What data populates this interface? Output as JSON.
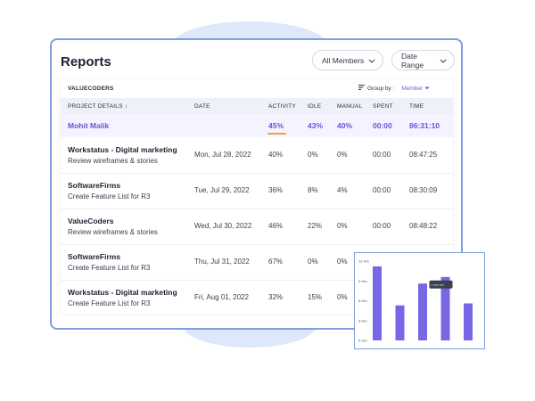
{
  "panel": {
    "title": "Reports",
    "members_dropdown": "All Members",
    "range_dropdown": "Date Range"
  },
  "table": {
    "org": "VALUECODERS",
    "group_label": "Group by :",
    "group_value": "Member",
    "columns": [
      "PROJECT DETAILS ↑",
      "DATE",
      "ACTIVITY",
      "IDLE",
      "MANUAL",
      "SPENT",
      "TIME"
    ],
    "summary": {
      "name": "Mohit Malik",
      "activity": "45%",
      "idle": "43%",
      "manual": "40%",
      "spent": "00:00",
      "time": "86:31:10"
    },
    "rows": [
      {
        "project": "Workstatus - Digital marketing",
        "task": "Review wireframes & stories",
        "date": "Mon, Jul 28, 2022",
        "activity": "40%",
        "idle": "0%",
        "manual": "0%",
        "spent": "00:00",
        "time": "08:47:25"
      },
      {
        "project": "SoftwareFirms",
        "task": "Create Feature List for R3",
        "date": "Tue, Jul 29, 2022",
        "activity": "36%",
        "idle": "8%",
        "manual": "4%",
        "spent": "00:00",
        "time": "08:30:09"
      },
      {
        "project": "ValueCoders",
        "task": "Review wireframes & stories",
        "date": "Wed, Jul 30, 2022",
        "activity": "46%",
        "idle": "22%",
        "manual": "0%",
        "spent": "00:00",
        "time": "08:48:22"
      },
      {
        "project": "SoftwareFirms",
        "task": "Create Feature List for R3",
        "date": "Thu, Jul 31, 2022",
        "activity": "67%",
        "idle": "0%",
        "manual": "0%",
        "spent": "",
        "time": ""
      },
      {
        "project": "Workstatus - Digital marketing",
        "task": "Create Feature List for R3",
        "date": "Fri, Aug 01, 2022",
        "activity": "32%",
        "idle": "15%",
        "manual": "0%",
        "spent": "",
        "time": ""
      }
    ]
  },
  "chart_data": {
    "type": "bar",
    "tick_labels": [
      "12 Hrs",
      "9 Hrs",
      "6 Hrs",
      "3 Hrs",
      "0 Hrs"
    ],
    "ticks": [
      12,
      9,
      6,
      3,
      0
    ],
    "ylim": [
      0,
      12
    ],
    "values": [
      11.2,
      5.3,
      8.6,
      9.6,
      5.6
    ],
    "tooltip_text": "▪ ▪▪▪▪▪ ▪▪▪▪"
  },
  "colors": {
    "accent": "#6654d9",
    "bar": "#7767e4",
    "panel_border": "#7f9ee0",
    "highlight_underline": "#f1a53a"
  }
}
